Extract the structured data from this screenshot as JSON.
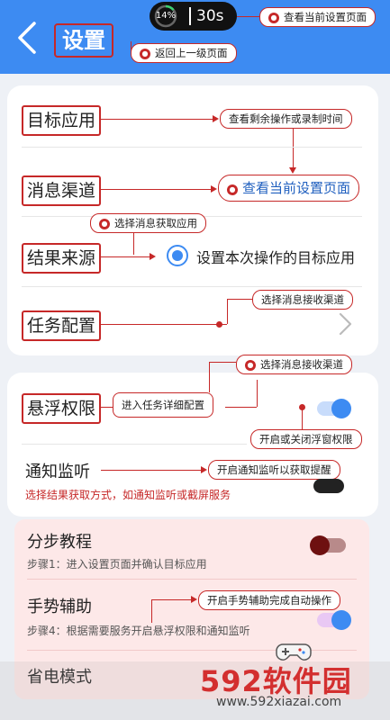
{
  "header": {
    "title": "设置",
    "timer": {
      "progress_percent": "14%",
      "progress_value": 0.14,
      "time": "30s"
    },
    "callout_view_page": "查看当前设置页面",
    "callout_back": "返回上一级页面"
  },
  "card1": {
    "rows": [
      {
        "label": "目标应用",
        "callout": "查看剩余操作或录制时间"
      },
      {
        "label": "消息渠道",
        "callout": "查看当前设置页面"
      },
      {
        "label": "结果来源",
        "callout": "选择消息获取应用",
        "radio_label": "设置本次操作的目标应用"
      },
      {
        "label": "任务配置",
        "callout": "选择消息接收渠道"
      }
    ]
  },
  "card2": {
    "float_label": "悬浮权限",
    "callout_top": "选择消息接收渠道",
    "callout_detail": "进入任务详细配置",
    "callout_toggle": "开启或关闭浮窗权限",
    "notify_label": "通知监听",
    "callout_notify": "开启通知监听以获取提醒",
    "notify_sub": "选择结果获取方式，如通知监听或截屏服务"
  },
  "card3": {
    "tutorial_label": "分步教程",
    "tutorial_sub": "步骤1：进入设置页面并确认目标应用",
    "gesture_label": "手势辅助",
    "gesture_callout": "开启手势辅助完成自动操作",
    "gesture_sub": "步骤4：根据需要服务开启悬浮权限和通知监听",
    "power_label": "省电模式"
  },
  "watermark": {
    "brand": "592软件园",
    "url": "www.592xiazai.com"
  },
  "colors": {
    "header_blue": "#3d8bf2",
    "annotation_red": "#c62828",
    "accent_blue": "#3d8bf2"
  },
  "icons": {
    "back": "chevron-left-icon",
    "next": "chevron-right-icon",
    "controller": "game-controller-icon"
  }
}
